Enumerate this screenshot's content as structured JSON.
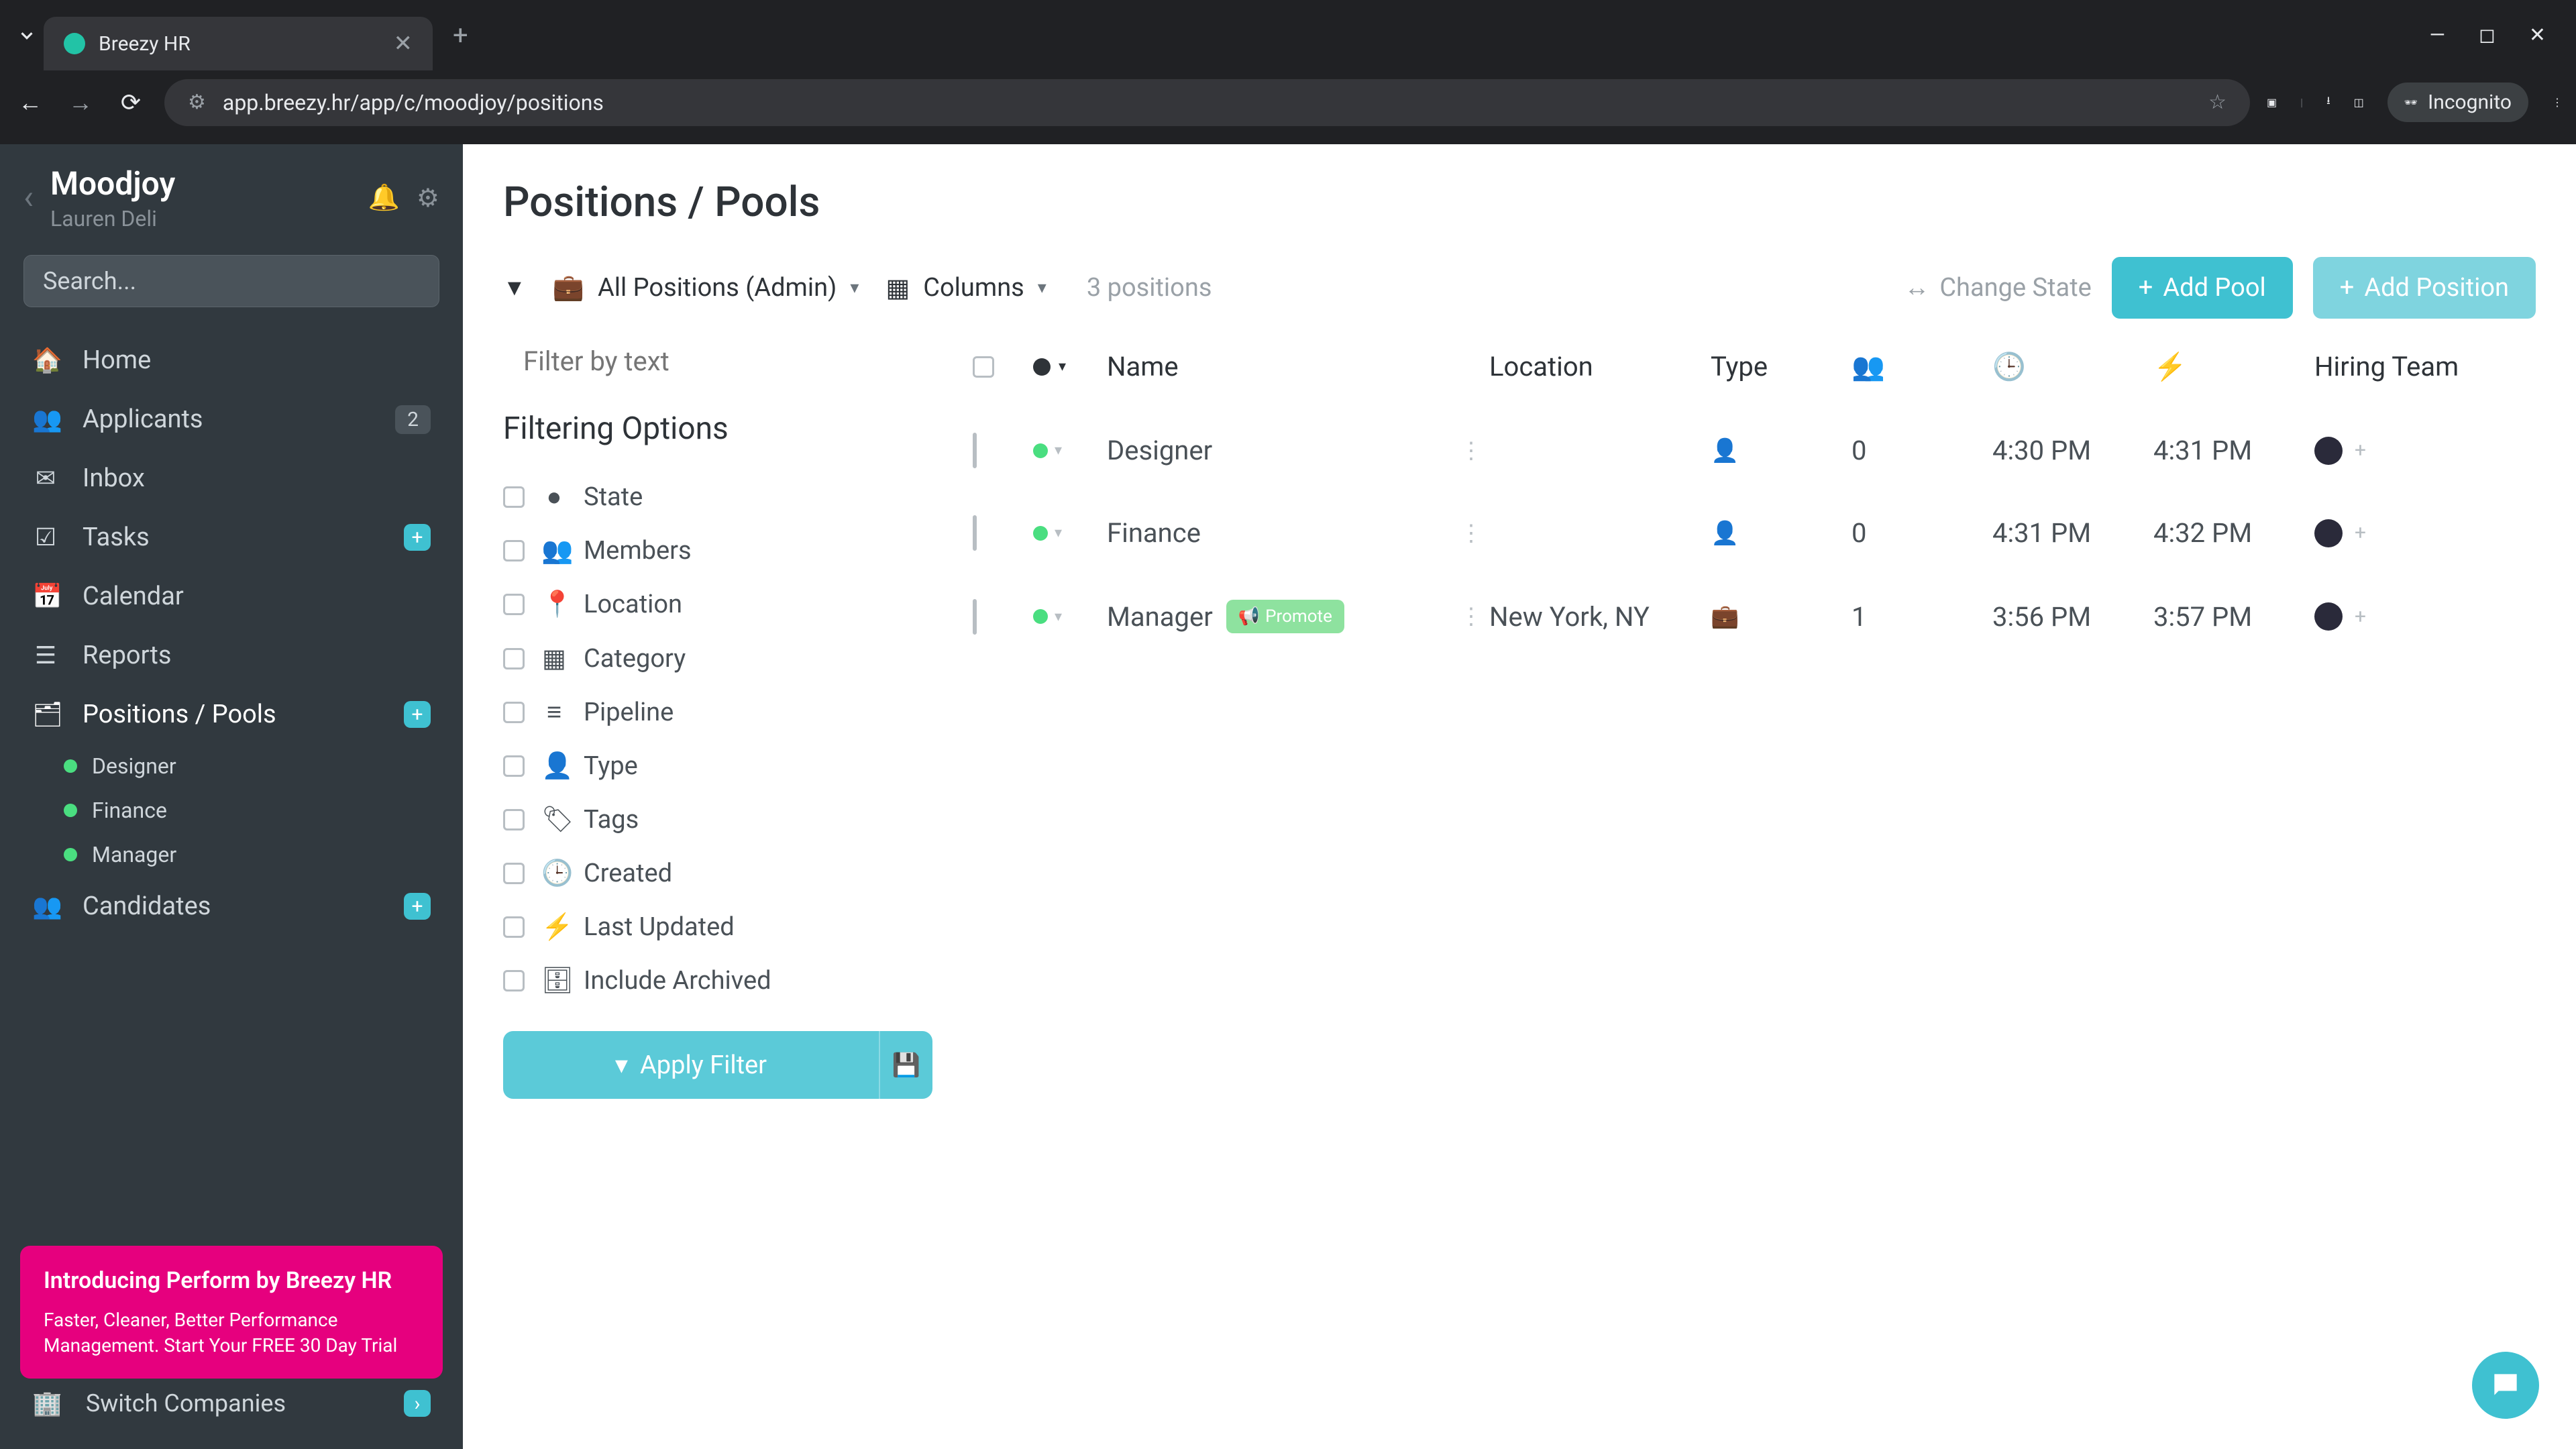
{
  "browser": {
    "tab_title": "Breezy HR",
    "url": "app.breezy.hr/app/c/moodjoy/positions",
    "incognito_label": "Incognito"
  },
  "sidebar": {
    "org": "Moodjoy",
    "user": "Lauren Deli",
    "search_placeholder": "Search...",
    "nav": {
      "home": "Home",
      "applicants": "Applicants",
      "applicants_badge": "2",
      "inbox": "Inbox",
      "tasks": "Tasks",
      "calendar": "Calendar",
      "reports": "Reports",
      "positions": "Positions / Pools",
      "candidates": "Candidates"
    },
    "positions_children": [
      "Designer",
      "Finance",
      "Manager"
    ],
    "promo": {
      "title": "Introducing Perform by Breezy HR",
      "body": "Faster, Cleaner, Better Performance Management. Start Your FREE 30 Day Trial"
    },
    "switch": "Switch Companies"
  },
  "page": {
    "title": "Positions / Pools",
    "toolbar": {
      "positions_dropdown": "All Positions (Admin)",
      "columns": "Columns",
      "count": "3 positions",
      "change_state": "Change State",
      "add_pool": "Add Pool",
      "add_position": "Add Position"
    },
    "filter": {
      "placeholder": "Filter by text",
      "heading": "Filtering Options",
      "options": {
        "state": "State",
        "members": "Members",
        "location": "Location",
        "category": "Category",
        "pipeline": "Pipeline",
        "type": "Type",
        "tags": "Tags",
        "created": "Created",
        "last_updated": "Last Updated",
        "include_archived": "Include Archived"
      },
      "apply": "Apply Filter"
    },
    "columns": {
      "name": "Name",
      "location": "Location",
      "type": "Type",
      "hiring_team": "Hiring Team"
    },
    "rows": [
      {
        "name": "Designer",
        "location": "",
        "type": "person",
        "count": "0",
        "created": "4:30 PM",
        "updated": "4:31 PM",
        "promote": false
      },
      {
        "name": "Finance",
        "location": "",
        "type": "person",
        "count": "0",
        "created": "4:31 PM",
        "updated": "4:32 PM",
        "promote": false
      },
      {
        "name": "Manager",
        "location": "New York, NY",
        "type": "briefcase",
        "count": "1",
        "created": "3:56 PM",
        "updated": "3:57 PM",
        "promote": true
      }
    ],
    "promote_label": "Promote"
  }
}
